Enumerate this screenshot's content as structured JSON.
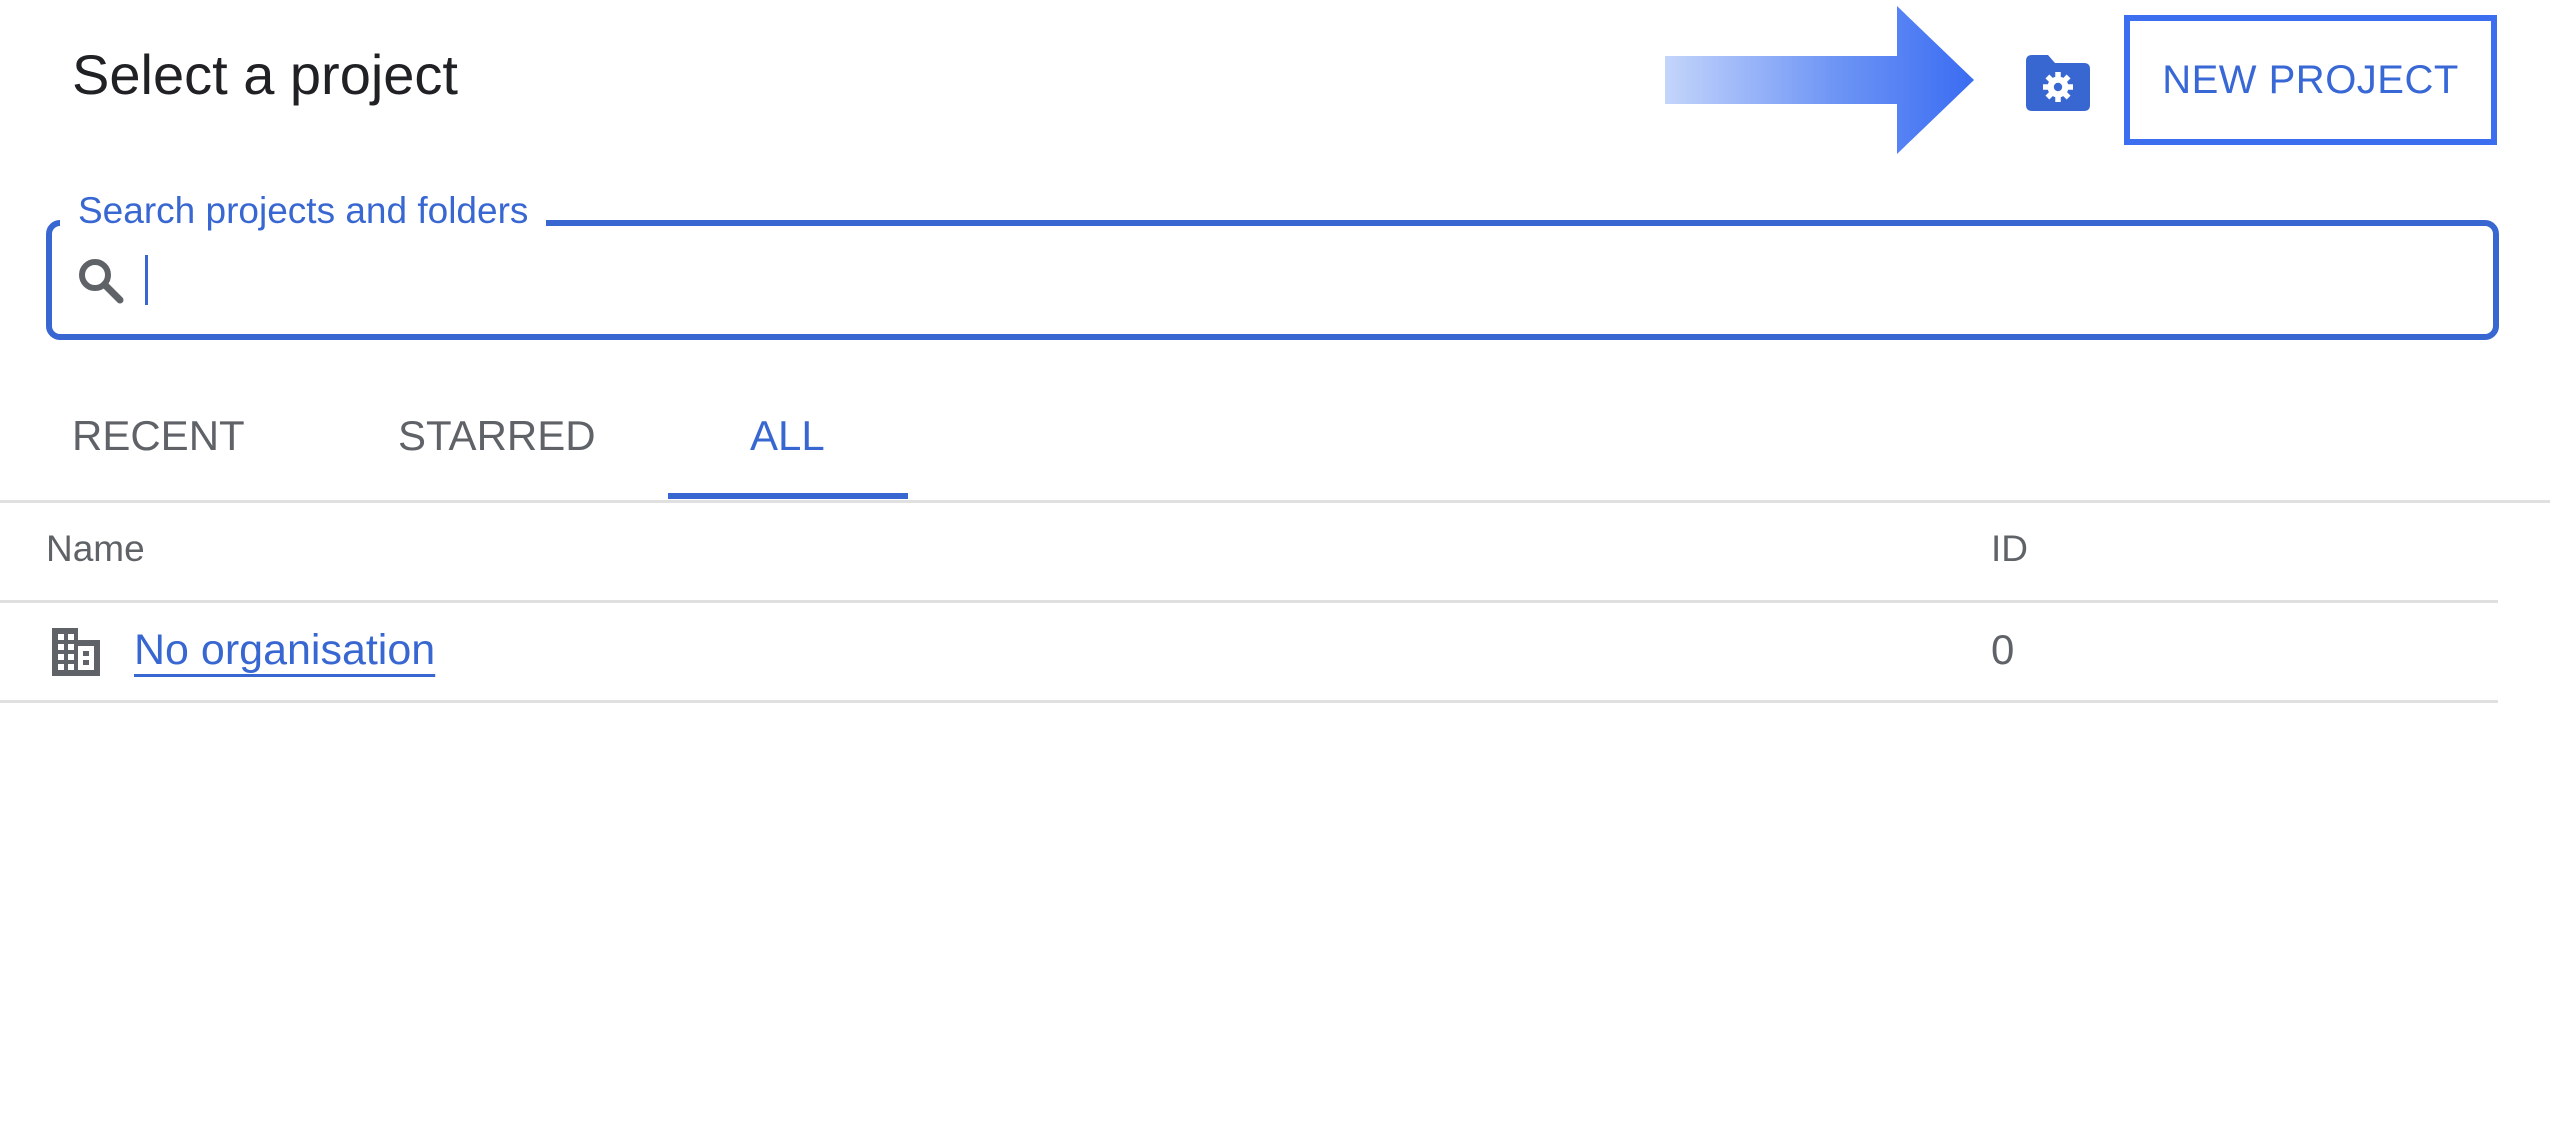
{
  "dialog": {
    "title": "Select a project"
  },
  "toolbar": {
    "manage_icon": "folder-settings-icon",
    "new_project_label": "NEW PROJECT"
  },
  "search": {
    "label": "Search projects and folders",
    "value": "",
    "placeholder": ""
  },
  "tabs": [
    {
      "label": "RECENT",
      "active": false
    },
    {
      "label": "STARRED",
      "active": false
    },
    {
      "label": "ALL",
      "active": true
    }
  ],
  "table": {
    "columns": [
      "Name",
      "ID"
    ],
    "rows": [
      {
        "icon": "building-icon",
        "name": "No organisation",
        "id": "0"
      }
    ]
  },
  "colors": {
    "accent": "#3967d2",
    "highlight": "#3b6ff0",
    "text_primary": "#202124",
    "text_secondary": "#5f6368",
    "divider": "#e0e0e0"
  }
}
